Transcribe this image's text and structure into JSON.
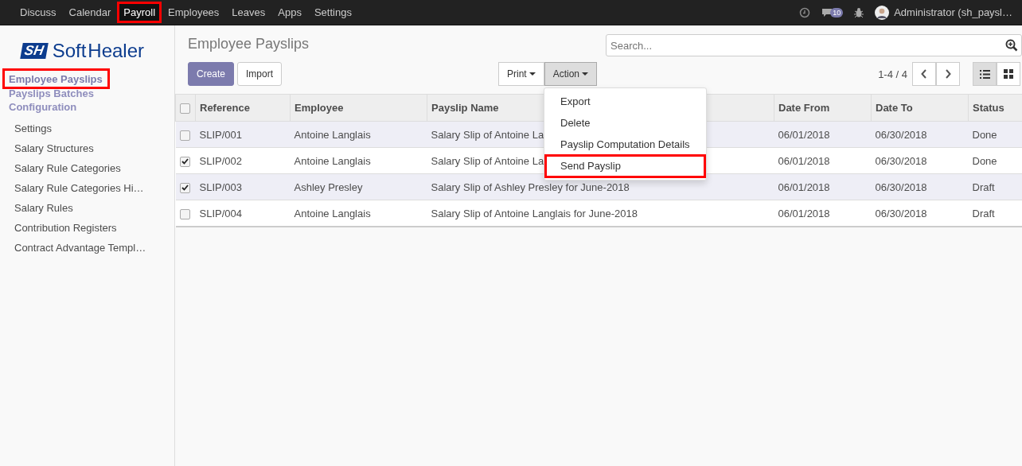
{
  "top_menu": [
    {
      "label": "Discuss",
      "selected": false,
      "highlighted": false
    },
    {
      "label": "Calendar",
      "selected": false,
      "highlighted": false
    },
    {
      "label": "Payroll",
      "selected": true,
      "highlighted": true
    },
    {
      "label": "Employees",
      "selected": false,
      "highlighted": false
    },
    {
      "label": "Leaves",
      "selected": false,
      "highlighted": false
    },
    {
      "label": "Apps",
      "selected": false,
      "highlighted": false
    },
    {
      "label": "Settings",
      "selected": false,
      "highlighted": false
    }
  ],
  "systray": {
    "message_count": "10",
    "user": "Administrator (sh_paysl…"
  },
  "logo": {
    "mark": "SH",
    "text": "Soft",
    "text2": "Healer"
  },
  "sidebar": {
    "sections": [
      {
        "label": "Employee Payslips",
        "selected": true,
        "highlighted": true
      },
      {
        "label": "Payslips Batches",
        "selected": false,
        "highlighted": false
      },
      {
        "label": "Configuration",
        "selected": false,
        "highlighted": false
      }
    ],
    "items": [
      "Settings",
      "Salary Structures",
      "Salary Rule Categories",
      "Salary Rule Categories Hi…",
      "Salary Rules",
      "Contribution Registers",
      "Contract Advantage Templ…"
    ]
  },
  "title": "Employee Payslips",
  "search": {
    "placeholder": "Search..."
  },
  "buttons": {
    "create": "Create",
    "import": "Import",
    "print": "Print",
    "action": "Action"
  },
  "pager": "1-4 / 4",
  "action_menu": [
    {
      "label": "Export",
      "highlighted": false
    },
    {
      "label": "Delete",
      "highlighted": false
    },
    {
      "label": "Payslip Computation Details",
      "highlighted": false
    },
    {
      "label": "Send Payslip",
      "highlighted": true
    }
  ],
  "table": {
    "select_all_checked": false,
    "columns": [
      "Reference",
      "Employee",
      "Payslip Name",
      "Date From",
      "Date To",
      "Status"
    ],
    "rows": [
      {
        "checked": false,
        "cells": [
          "SLIP/001",
          "Antoine Langlais",
          "Salary Slip of Antoine La",
          "06/01/2018",
          "06/30/2018",
          "Done"
        ]
      },
      {
        "checked": true,
        "cells": [
          "SLIP/002",
          "Antoine Langlais",
          "Salary Slip of Antoine La",
          "06/01/2018",
          "06/30/2018",
          "Done"
        ]
      },
      {
        "checked": true,
        "cells": [
          "SLIP/003",
          "Ashley Presley",
          "Salary Slip of Ashley Presley for June-2018",
          "06/01/2018",
          "06/30/2018",
          "Draft"
        ]
      },
      {
        "checked": false,
        "cells": [
          "SLIP/004",
          "Antoine Langlais",
          "Salary Slip of Antoine Langlais for June-2018",
          "06/01/2018",
          "06/30/2018",
          "Draft"
        ]
      }
    ]
  }
}
